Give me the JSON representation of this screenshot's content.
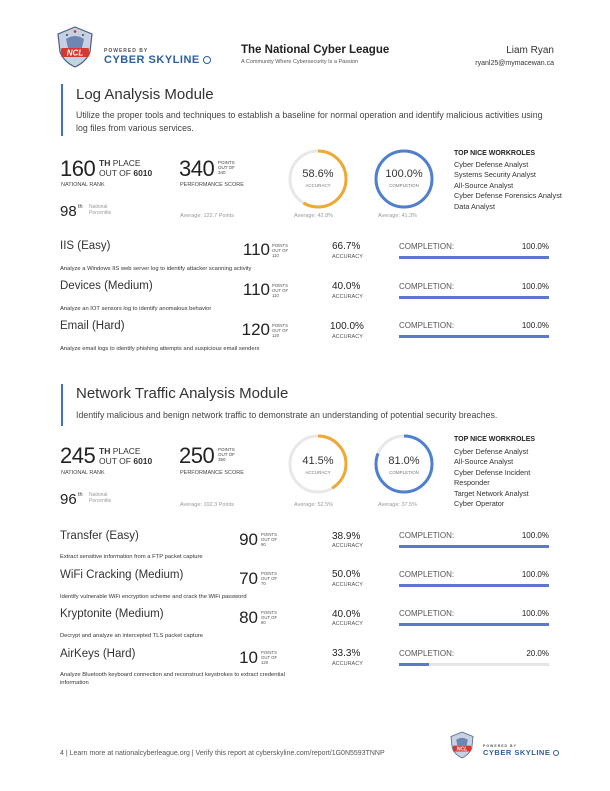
{
  "header": {
    "logo_text": "NCL",
    "powered_by": "POWERED BY",
    "brand": "CYBER SKYLINE",
    "title": "The National Cyber League",
    "subtitle": "A Community Where Cybersecurity Is a Passion",
    "name": "Liam Ryan",
    "email": "ryanl25@mymacewan.ca"
  },
  "modules": [
    {
      "title": "Log Analysis Module",
      "description": "Utilize the proper tools and techniques to establish a baseline for normal operation and identify malicious activities using log files from various services.",
      "rank": "160",
      "rank_th": "TH",
      "rank_place": "PLACE",
      "rank_out_of": "OUT OF",
      "rank_total": "6010",
      "rank_label": "NATIONAL RANK",
      "percentile": "98",
      "percentile_th": "th",
      "percentile_label_1": "National",
      "percentile_label_2": "Percentile",
      "points": "340",
      "points_label_1": "POINTS",
      "points_label_2": "OUT OF",
      "points_total": "340",
      "points_caption": "PERFORMANCE SCORE",
      "points_avg": "Average: 122.7 Points",
      "accuracy": "58.6%",
      "accuracy_value": 58.6,
      "accuracy_label": "ACCURACY",
      "accuracy_avg": "Average: 42.8%",
      "completion": "100.0%",
      "completion_value": 100.0,
      "completion_label": "COMPLETION",
      "completion_avg": "Average: 41.3%",
      "workroles_heading": "TOP NICE WORKROLES",
      "workroles": [
        "Cyber Defense Analyst",
        "Systems Security Analyst",
        "All-Source Analyst",
        "Cyber Defense Forensics Analyst",
        "Data Analyst"
      ],
      "challenges": [
        {
          "name": "IIS (Easy)",
          "points": "110",
          "pts_l1": "POINTS",
          "pts_l2": "OUT OF",
          "pts_total": "110",
          "accuracy": "66.7%",
          "acc_label": "ACCURACY",
          "completion_label": "COMPLETION:",
          "completion": "100.0%",
          "completion_value": 100.0,
          "description": "Analyze a Windows IIS web server log to identify attacker scanning activity"
        },
        {
          "name": "Devices (Medium)",
          "points": "110",
          "pts_l1": "POINTS",
          "pts_l2": "OUT OF",
          "pts_total": "110",
          "accuracy": "40.0%",
          "acc_label": "ACCURACY",
          "completion_label": "COMPLETION:",
          "completion": "100.0%",
          "completion_value": 100.0,
          "description": "Analyze an IOT sensors log to identify anomalous behavior"
        },
        {
          "name": "Email (Hard)",
          "points": "120",
          "pts_l1": "POINTS",
          "pts_l2": "OUT OF",
          "pts_total": "120",
          "accuracy": "100.0%",
          "acc_label": "ACCURACY",
          "completion_label": "COMPLETION:",
          "completion": "100.0%",
          "completion_value": 100.0,
          "description": "Analyze email logs to identify phishing attempts and suspicious email senders"
        }
      ]
    },
    {
      "title": "Network Traffic Analysis Module",
      "description": "Identify malicious and benign network traffic to demonstrate an understanding of potential security breaches.",
      "rank": "245",
      "rank_th": "TH",
      "rank_place": "PLACE",
      "rank_out_of": "OUT OF",
      "rank_total": "6010",
      "rank_label": "NATIONAL RANK",
      "percentile": "96",
      "percentile_th": "th",
      "percentile_label_1": "National",
      "percentile_label_2": "Percentile",
      "points": "250",
      "points_label_1": "POINTS",
      "points_label_2": "OUT OF",
      "points_total": "350",
      "points_caption": "PERFORMANCE SCORE",
      "points_avg": "Average: 102.3 Points",
      "accuracy": "41.5%",
      "accuracy_value": 41.5,
      "accuracy_label": "ACCURACY",
      "accuracy_avg": "Average: 52.5%",
      "completion": "81.0%",
      "completion_value": 81.0,
      "completion_label": "COMPLETION",
      "completion_avg": "Average: 37.5%",
      "workroles_heading": "TOP NICE WORKROLES",
      "workroles": [
        "Cyber Defense Analyst",
        "All-Source Analyst",
        "Cyber Defense Incident Responder",
        "Target Network Analyst",
        "Cyber Operator"
      ],
      "challenges": [
        {
          "name": "Transfer (Easy)",
          "points": "90",
          "pts_l1": "POINTS",
          "pts_l2": "OUT OF",
          "pts_total": "90",
          "accuracy": "38.9%",
          "acc_label": "ACCURACY",
          "completion_label": "COMPLETION:",
          "completion": "100.0%",
          "completion_value": 100.0,
          "description": "Extract sensitive information from a FTP packet capture"
        },
        {
          "name": "WiFi Cracking (Medium)",
          "points": "70",
          "pts_l1": "POINTS",
          "pts_l2": "OUT OF",
          "pts_total": "70",
          "accuracy": "50.0%",
          "acc_label": "ACCURACY",
          "completion_label": "COMPLETION:",
          "completion": "100.0%",
          "completion_value": 100.0,
          "description": "Identify vulnerable WiFi encryption scheme and crack the WiFi password"
        },
        {
          "name": "Kryptonite (Medium)",
          "points": "80",
          "pts_l1": "POINTS",
          "pts_l2": "OUT OF",
          "pts_total": "80",
          "accuracy": "40.0%",
          "acc_label": "ACCURACY",
          "completion_label": "COMPLETION:",
          "completion": "100.0%",
          "completion_value": 100.0,
          "description": "Decrypt and analyze an intercepted TLS packet capture"
        },
        {
          "name": "AirKeys (Hard)",
          "points": "10",
          "pts_l1": "POINTS",
          "pts_l2": "OUT OF",
          "pts_total": "120",
          "accuracy": "33.3%",
          "acc_label": "ACCURACY",
          "completion_label": "COMPLETION:",
          "completion": "20.0%",
          "completion_value": 20.0,
          "description": "Analyze Bluetooth keyboard connection and reconstruct keystrokes to extract credential information"
        }
      ]
    }
  ],
  "footer": {
    "text": "4  |  Learn more at nationalcyberleague.org  |  Verify this report at cyberskyline.com/report/1G0N5593TNNP",
    "logo_text": "NCL",
    "powered_by": "POWERED BY",
    "brand": "CYBER SKYLINE"
  },
  "colors": {
    "accent_blue": "#3f74b8",
    "accuracy_ring": "#f0a830",
    "completion_ring": "#4f7fcf",
    "bar_fill": "#5f77c9"
  }
}
